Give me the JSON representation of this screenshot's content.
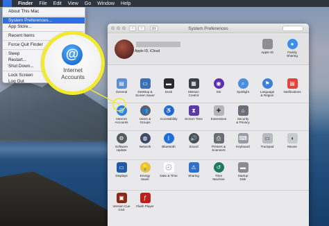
{
  "menubar": {
    "apple_glyph": "",
    "items": [
      "Finder",
      "File",
      "Edit",
      "View",
      "Go",
      "Window",
      "Help"
    ]
  },
  "apple_menu": {
    "items": [
      {
        "label": "About This Mac",
        "selected": false
      },
      {
        "sep": true
      },
      {
        "label": "System Preferences...",
        "selected": true
      },
      {
        "label": "App Store...",
        "selected": false
      },
      {
        "sep": true
      },
      {
        "label": "Recent Items",
        "selected": false
      },
      {
        "sep": true
      },
      {
        "label": "Force Quit Finder",
        "selected": false
      },
      {
        "sep": true
      },
      {
        "label": "Sleep",
        "selected": false
      },
      {
        "label": "Restart...",
        "selected": false
      },
      {
        "label": "Shut Down...",
        "selected": false
      },
      {
        "sep": true
      },
      {
        "label": "Lock Screen",
        "selected": false
      },
      {
        "label": "Log Out",
        "selected": false
      }
    ]
  },
  "window": {
    "title": "System Preferences",
    "account_subtitle": "Apple ID, iCloud",
    "top_right": [
      {
        "name": "apple-id",
        "label": "Apple ID",
        "icon": "apple-icon",
        "color": "#8e8e93"
      },
      {
        "name": "family-sharing",
        "label": "Family\nSharing",
        "icon": "family-icon",
        "color": "#3b8fe8"
      }
    ],
    "rows": [
      [
        {
          "name": "general",
          "label": "General",
          "icon": "file-icon",
          "color": "#5a8fd6",
          "glyph": "▤"
        },
        {
          "name": "desktop-screen-saver",
          "label": "Desktop &\nScreen Saver",
          "icon": "desktop-icon",
          "color": "#3c6fb3",
          "glyph": "▭"
        },
        {
          "name": "dock",
          "label": "Dock",
          "icon": "dock-icon",
          "color": "#2b2b2e",
          "glyph": "▬"
        },
        {
          "name": "mission-control",
          "label": "Mission\nControl",
          "icon": "mission-control-icon",
          "color": "#3a3f4a",
          "glyph": "▦"
        },
        {
          "name": "siri",
          "label": "Siri",
          "icon": "siri-icon",
          "color": "#5b2fb0",
          "glyph": "◉",
          "round": true
        },
        {
          "name": "spotlight",
          "label": "Spotlight",
          "icon": "spotlight-icon",
          "color": "#4a8ee0",
          "glyph": "⌕",
          "round": true
        },
        {
          "name": "language-region",
          "label": "Language\n& Region",
          "icon": "flag-icon",
          "color": "#3b7fd8",
          "glyph": "⚑",
          "round": true
        },
        {
          "name": "notifications",
          "label": "Notifications",
          "icon": "notifications-icon",
          "color": "#e2423a",
          "glyph": "▤"
        }
      ],
      [
        {
          "name": "internet-accounts",
          "label": "Internet\nAccounts",
          "icon": "at-icon",
          "color": "#2d7fe0",
          "glyph": "@",
          "round": true
        },
        {
          "name": "users-groups",
          "label": "Users &\nGroups",
          "icon": "users-icon",
          "color": "#5d6068",
          "glyph": "👥",
          "round": true
        },
        {
          "name": "accessibility",
          "label": "Accessibility",
          "icon": "accessibility-icon",
          "color": "#1f6fd8",
          "glyph": "♿",
          "round": true
        },
        {
          "name": "screen-time",
          "label": "Screen Time",
          "icon": "hourglass-icon",
          "color": "#5b3aa8",
          "glyph": "⧗"
        },
        {
          "name": "extensions",
          "label": "Extensions",
          "icon": "puzzle-icon",
          "color": "#b5b5b8",
          "glyph": "✚"
        },
        {
          "name": "security-privacy",
          "label": "Security\n& Privacy",
          "icon": "house-lock-icon",
          "color": "#6b6f78",
          "glyph": "⌂"
        }
      ],
      [
        {
          "name": "software-update",
          "label": "Software\nUpdate",
          "icon": "gear-icon",
          "color": "#56595f",
          "glyph": "⚙",
          "round": true
        },
        {
          "name": "network",
          "label": "Network",
          "icon": "globe-icon",
          "color": "#3c4a66",
          "glyph": "◍",
          "round": true
        },
        {
          "name": "bluetooth",
          "label": "Bluetooth",
          "icon": "bluetooth-icon",
          "color": "#1f6fd8",
          "glyph": "ᛒ",
          "round": true
        },
        {
          "name": "sound",
          "label": "Sound",
          "icon": "speaker-icon",
          "color": "#4b4d52",
          "glyph": "🔊",
          "round": true
        },
        {
          "name": "printers-scanners",
          "label": "Printers &\nScanners",
          "icon": "printer-icon",
          "color": "#6b6d72",
          "glyph": "⎙"
        },
        {
          "name": "keyboard",
          "label": "Keyboard",
          "icon": "keyboard-icon",
          "color": "#9a9ca1",
          "glyph": "⌨"
        },
        {
          "name": "trackpad",
          "label": "Trackpad",
          "icon": "trackpad-icon",
          "color": "#b8babe",
          "glyph": "▭"
        },
        {
          "name": "mouse",
          "label": "Mouse",
          "icon": "mouse-icon",
          "color": "#c9cacc",
          "glyph": "◖"
        }
      ],
      [
        {
          "name": "displays",
          "label": "Displays",
          "icon": "display-icon",
          "color": "#1e5ca8",
          "glyph": "▭"
        },
        {
          "name": "energy-saver",
          "label": "Energy\nSaver",
          "icon": "lightbulb-icon",
          "color": "#e7c23a",
          "glyph": "💡",
          "round": true
        },
        {
          "name": "date-time",
          "label": "Date & Time",
          "icon": "calendar-icon",
          "color": "#ffffff",
          "glyph": "🕘"
        },
        {
          "name": "sharing",
          "label": "Sharing",
          "icon": "sharing-icon",
          "color": "#2f70c9",
          "glyph": "⚠"
        },
        {
          "name": "time-machine",
          "label": "Time\nMachine",
          "icon": "time-machine-icon",
          "color": "#1d7a5c",
          "glyph": "↺",
          "round": true
        },
        {
          "name": "startup-disk",
          "label": "Startup\nDisk",
          "icon": "disk-icon",
          "color": "#8a8c90",
          "glyph": "▬"
        }
      ],
      [
        {
          "name": "version-cue",
          "label": "Version Cue\nCS4",
          "icon": "version-cue-icon",
          "color": "#8a2a14",
          "glyph": "▣"
        },
        {
          "name": "flash-player",
          "label": "Flash Player",
          "icon": "flash-icon",
          "color": "#b8221b",
          "glyph": "ƒ"
        }
      ]
    ]
  },
  "callout": {
    "glyph": "@",
    "label": "Internet\nAccounts",
    "ring_color": "#f2ea2e"
  }
}
